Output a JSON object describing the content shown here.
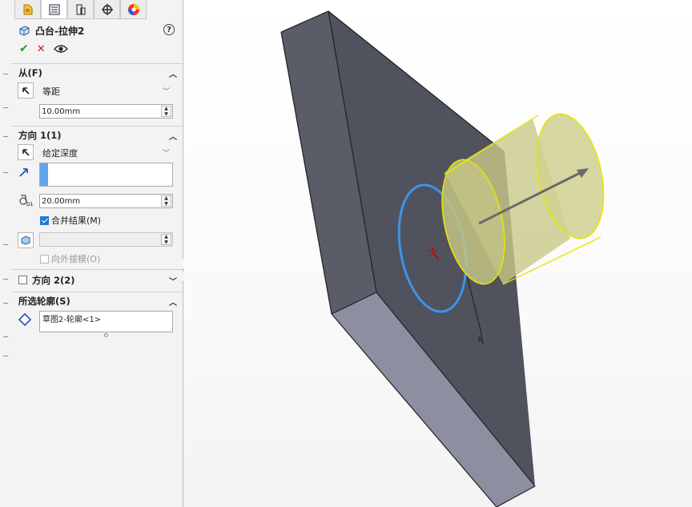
{
  "header_fragment": "",
  "tabs": [
    {
      "name": "feature-manager",
      "icon": "feature-tree-icon"
    },
    {
      "name": "property-manager",
      "icon": "property-list-icon"
    },
    {
      "name": "configuration-manager",
      "icon": "config-icon"
    },
    {
      "name": "dimxpert-manager",
      "icon": "crosshair-icon"
    },
    {
      "name": "display-manager",
      "icon": "appearance-icon"
    }
  ],
  "feature": {
    "title": "凸台-拉伸2",
    "help": "?"
  },
  "from_section": {
    "label": "从(F)",
    "start_condition": "等距",
    "offset_value": "10.00mm"
  },
  "direction1_section": {
    "label": "方向 1(1)",
    "end_condition": "给定深度",
    "depth_value": "20.00mm",
    "merge_result_label": "合并结果(M)",
    "merge_result_checked": true,
    "draft_outward_label": "向外拔模(O)",
    "draft_outward_checked": false
  },
  "direction2_section": {
    "label": "方向 2(2)",
    "checked": false
  },
  "selected_contours_section": {
    "label": "所选轮廓(S)",
    "items": [
      "草图2-轮廓<1>"
    ]
  },
  "colors": {
    "body_face": "#50525d",
    "body_side": "#8d8fa0",
    "preview_fill": "#c9c98a",
    "preview_edge": "#e6e600",
    "sketch_circle": "#3d94e8"
  }
}
